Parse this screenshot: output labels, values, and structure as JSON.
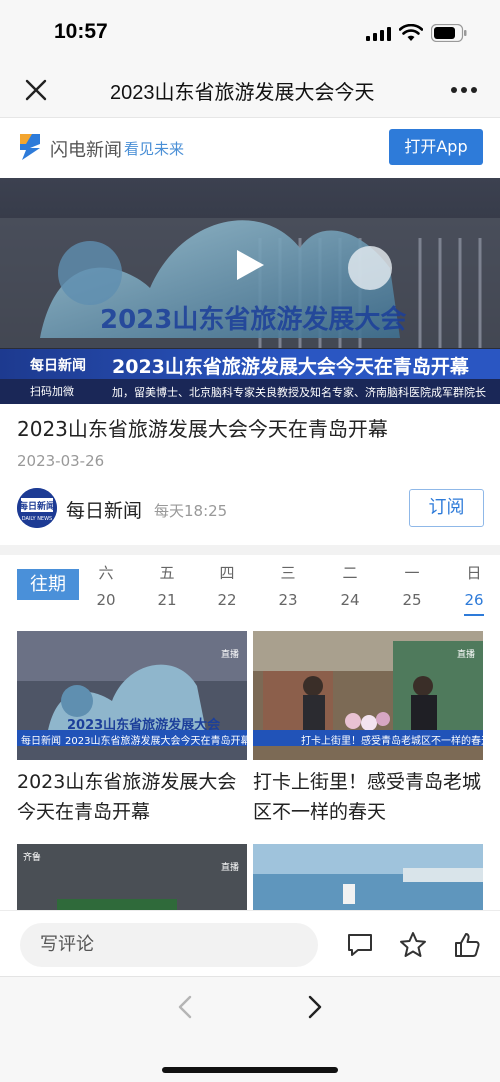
{
  "status_bar": {
    "time": "10:57"
  },
  "nav": {
    "title": "2023山东省旅游发展大会今天"
  },
  "banner": {
    "brand_name": "闪电新闻",
    "slogan": "看见未来",
    "open_app_label": "打开App"
  },
  "video": {
    "station_logo": "每日新闻",
    "caption": "2023山东省旅游发展大会今天在青岛开幕",
    "ticker_label": "扫码加微",
    "ticker_text": "加，留美博士、北京脑科专家关良教授及知名专家、济南脑科医院成军群院长"
  },
  "article": {
    "title": "2023山东省旅游发展大会今天在青岛开幕",
    "date": "2023-03-26",
    "channel_name": "每日新闻",
    "channel_schedule": "每天18:25",
    "channel_avatar_text": "每日新闻",
    "channel_avatar_sub": "DAILY NEWS",
    "subscribe_label": "订阅"
  },
  "past": {
    "label": "往期",
    "days": [
      {
        "weekday": "六",
        "date": "20"
      },
      {
        "weekday": "五",
        "date": "21"
      },
      {
        "weekday": "四",
        "date": "22"
      },
      {
        "weekday": "三",
        "date": "23"
      },
      {
        "weekday": "二",
        "date": "24"
      },
      {
        "weekday": "一",
        "date": "25"
      },
      {
        "weekday": "日",
        "date": "26"
      }
    ],
    "active_day": 6
  },
  "cards": [
    {
      "title": "2023山东省旅游发展大会今天在青岛开幕",
      "bar": "2023山东省旅游发展大会今天在青岛开幕",
      "live": "直播",
      "badge": "每日新闻"
    },
    {
      "title": "打卡上街里！感受青岛老城区不一样的春天",
      "bar": "打卡上街里！感受青岛老城区不一样的春天",
      "live": "直播",
      "badge": ""
    },
    {
      "title": "",
      "bar": "",
      "live": "直播",
      "badge": "齐鲁"
    },
    {
      "title": "",
      "bar": "",
      "live": "",
      "badge": ""
    }
  ],
  "comment": {
    "placeholder": "写评论"
  },
  "colors": {
    "accent": "#2e7bd9",
    "past_label": "#4a90d9"
  }
}
